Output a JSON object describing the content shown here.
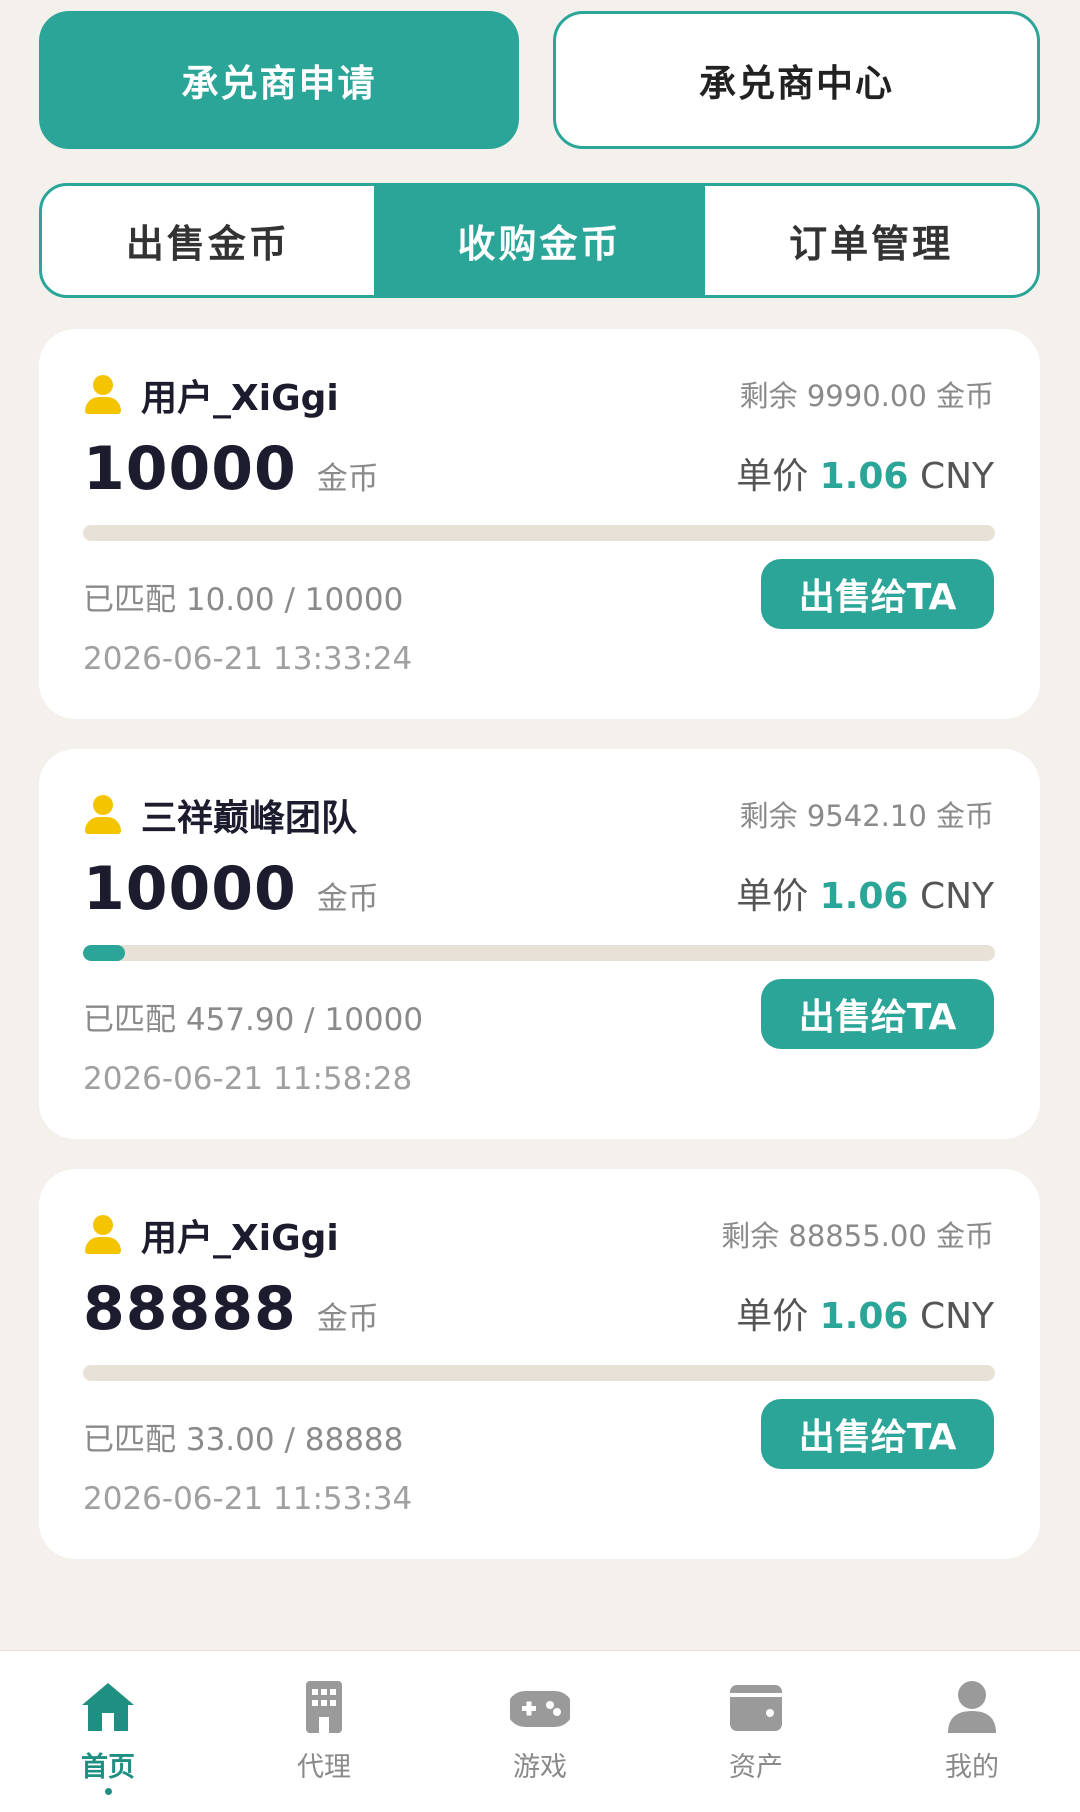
{
  "top_buttons": {
    "apply": "承兑商申请",
    "center": "承兑商中心"
  },
  "tabs": [
    {
      "label": "出售金币",
      "active": false
    },
    {
      "label": "收购金币",
      "active": true
    },
    {
      "label": "订单管理",
      "active": false
    }
  ],
  "orders": [
    {
      "user": "用户_XiGgi",
      "remaining": "剩余 9990.00 金币",
      "amount": "10000",
      "amount_unit": "金币",
      "price_label": "单价",
      "price_value": "1.06",
      "price_currency": "CNY",
      "matched": "已匹配 10.00 / 10000",
      "matched_fraction": 0.001,
      "button": "出售给TA",
      "time": "2026-06-21 13:33:24"
    },
    {
      "user": "三祥巅峰团队",
      "remaining": "剩余 9542.10 金币",
      "amount": "10000",
      "amount_unit": "金币",
      "price_label": "单价",
      "price_value": "1.06",
      "price_currency": "CNY",
      "matched": "已匹配 457.90 / 10000",
      "matched_fraction": 0.0458,
      "button": "出售给TA",
      "time": "2026-06-21 11:58:28"
    },
    {
      "user": "用户_XiGgi",
      "remaining": "剩余 88855.00 金币",
      "amount": "88888",
      "amount_unit": "金币",
      "price_label": "单价",
      "price_value": "1.06",
      "price_currency": "CNY",
      "matched": "已匹配 33.00 / 88888",
      "matched_fraction": 0.00037,
      "button": "出售给TA",
      "time": "2026-06-21 11:53:34"
    }
  ],
  "nav": [
    {
      "label": "首页",
      "icon": "home-icon",
      "active": true
    },
    {
      "label": "代理",
      "icon": "building-icon",
      "active": false
    },
    {
      "label": "游戏",
      "icon": "gamepad-icon",
      "active": false
    },
    {
      "label": "资产",
      "icon": "wallet-icon",
      "active": false
    },
    {
      "label": "我的",
      "icon": "user-icon",
      "active": false
    }
  ],
  "colors": {
    "accent": "#2aa597",
    "background": "#f4f0ec",
    "user_icon": "#f5c400"
  }
}
